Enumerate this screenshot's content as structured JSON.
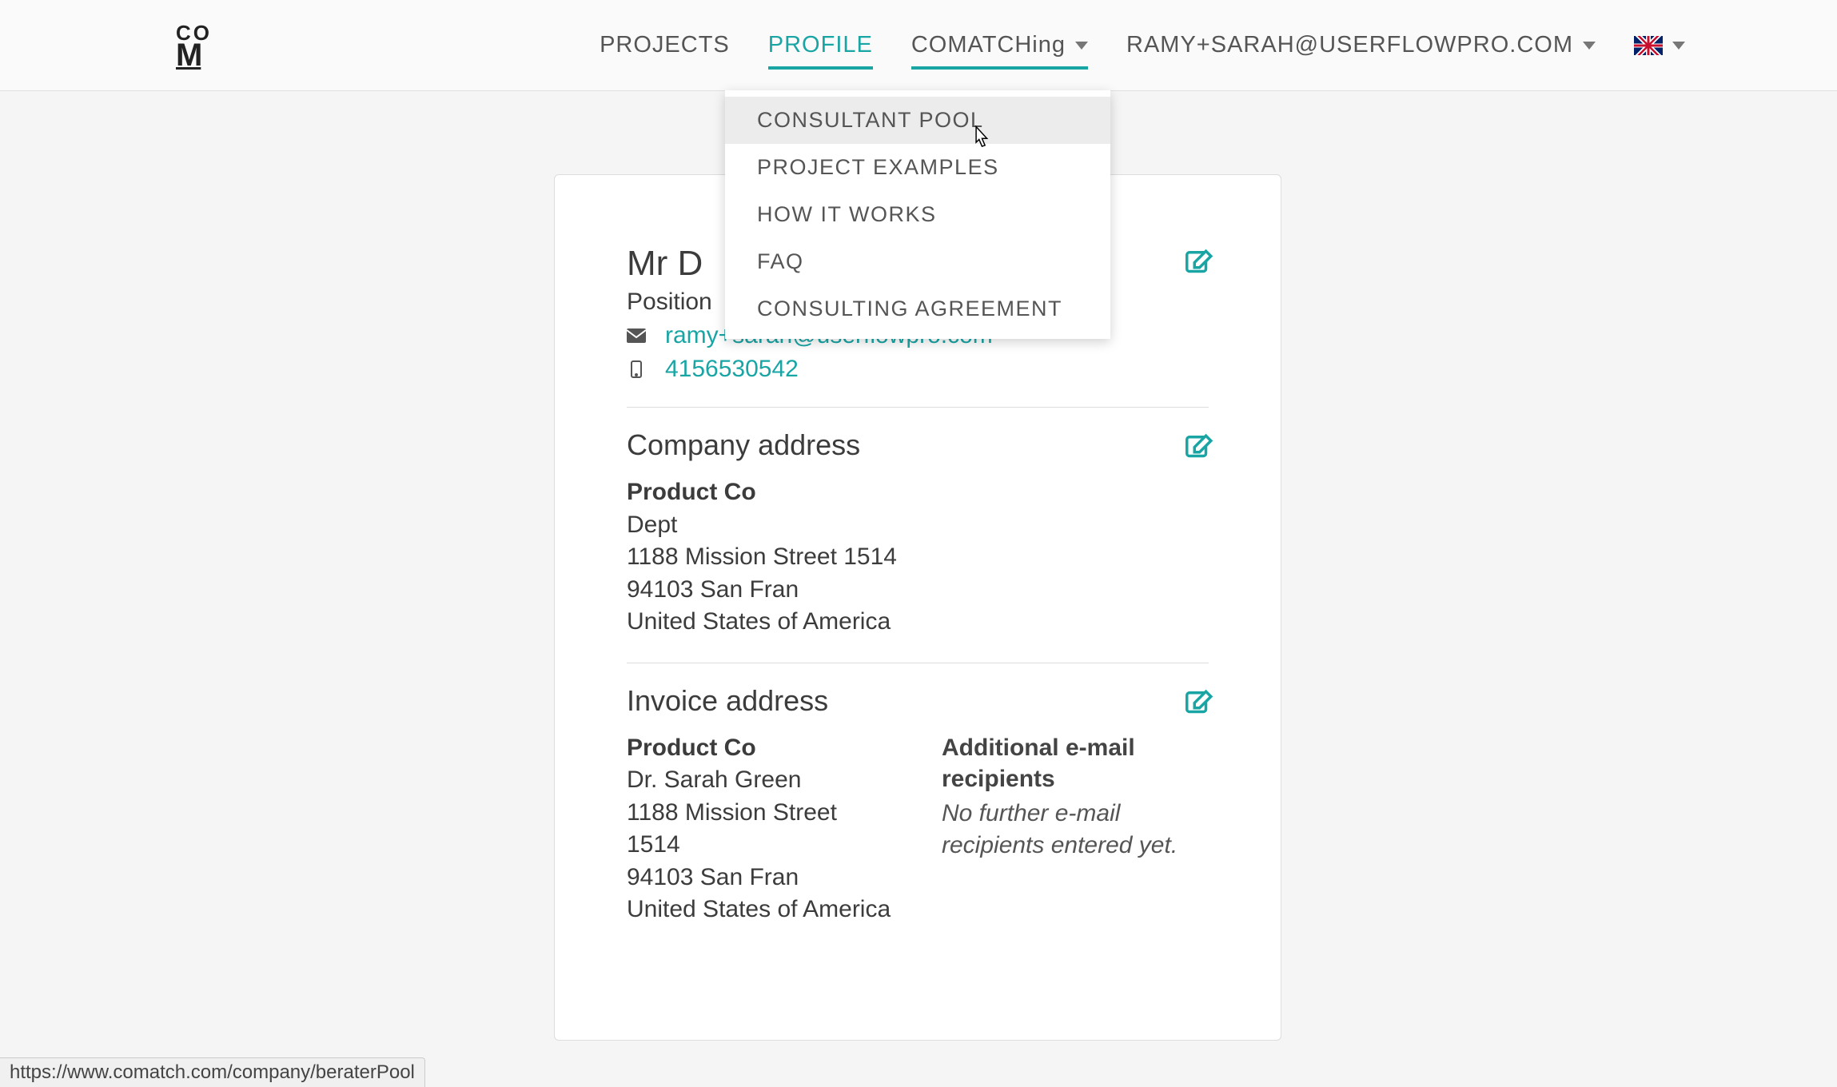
{
  "colors": {
    "accent": "#1aa5a5"
  },
  "nav": {
    "projects": "PROJECTS",
    "profile": "PROFILE",
    "comatching": "COMATCHing",
    "account": "RAMY+SARAH@USERFLOWPRO.COM"
  },
  "dropdown": {
    "items": [
      "CONSULTANT POOL",
      "PROJECT EXAMPLES",
      "HOW IT WORKS",
      "FAQ",
      "CONSULTING AGREEMENT"
    ]
  },
  "profile": {
    "title_partial": "Mr D",
    "position_label": "Position",
    "email": "ramy+sarah@userflowpro.com",
    "phone": "4156530542"
  },
  "company_address": {
    "heading": "Company address",
    "name": "Product Co",
    "dept": "Dept",
    "street": "1188 Mission Street 1514",
    "city_zip": "94103 San Fran",
    "country": "United States of America"
  },
  "invoice_address": {
    "heading": "Invoice address",
    "name": "Product Co",
    "person": "Dr. Sarah Green",
    "street": "1188 Mission Street 1514",
    "city_zip": "94103 San Fran",
    "country": "United States of America",
    "recipients_label": "Additional e-mail recipients",
    "recipients_empty": "No further e-mail recipients entered yet."
  },
  "status_url": "https://www.comatch.com/company/beraterPool"
}
